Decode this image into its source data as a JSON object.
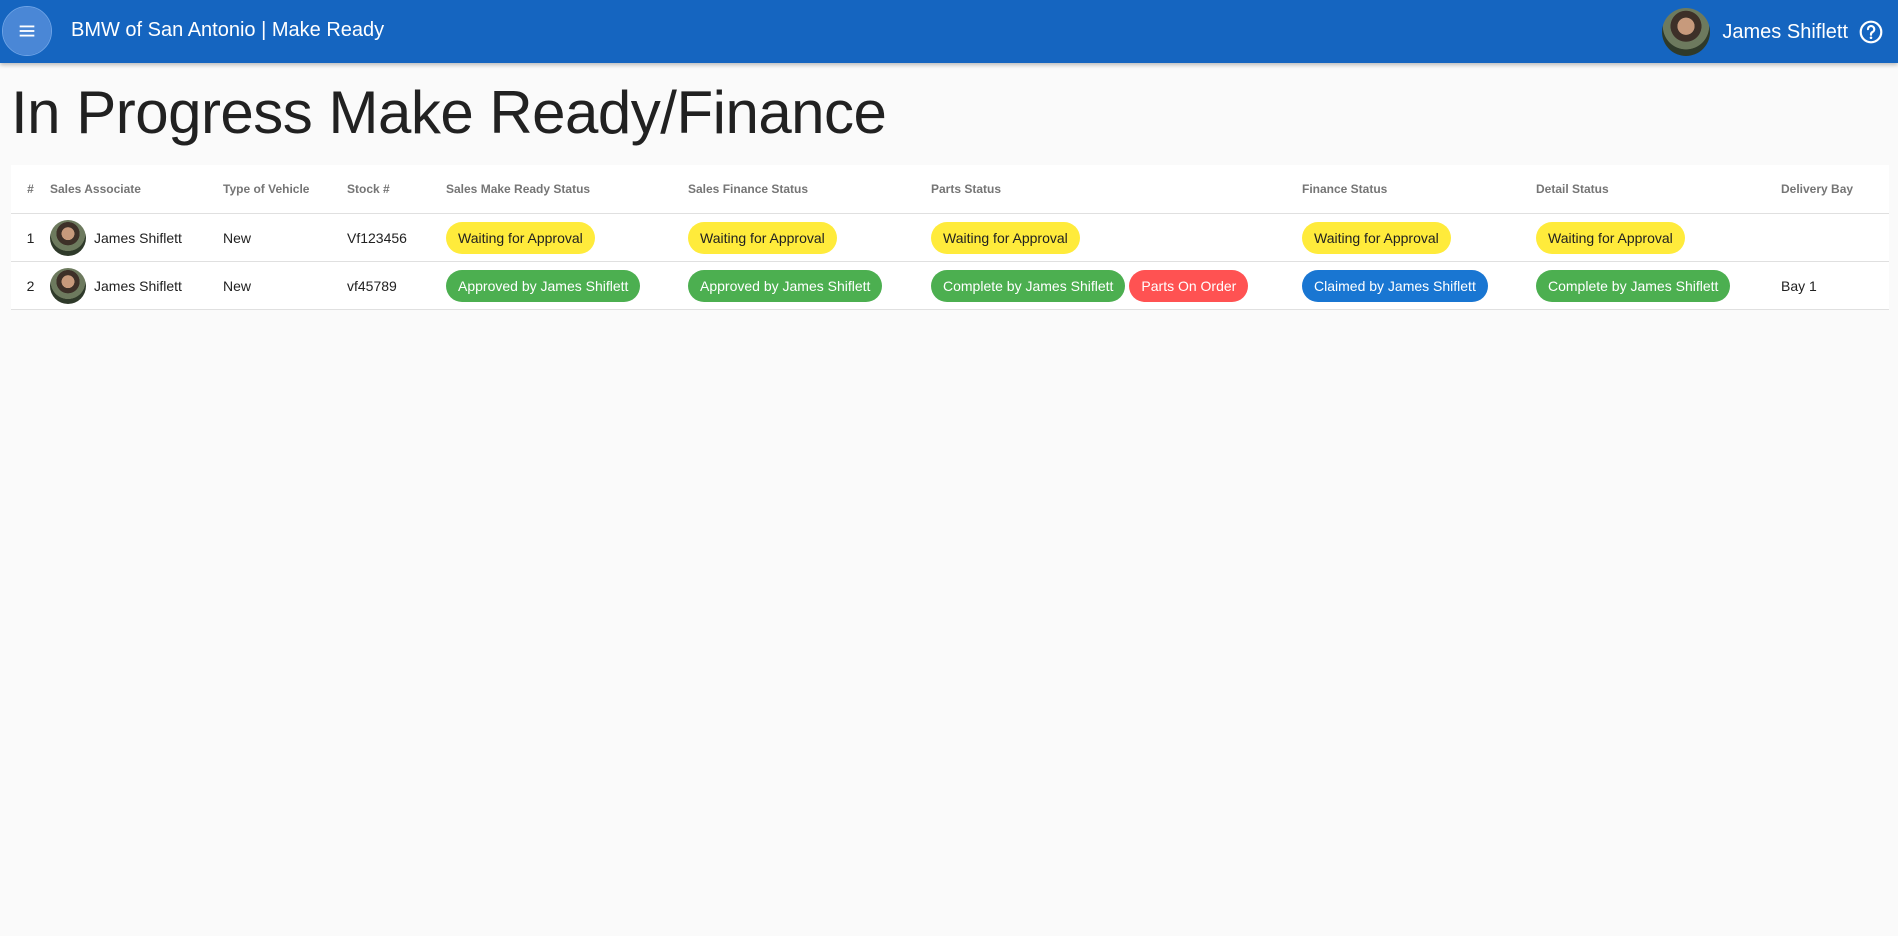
{
  "header": {
    "title": "BMW of San Antonio | Make Ready",
    "user_name": "James Shiflett",
    "bg_color": "#1565c0"
  },
  "page": {
    "title": "In Progress Make Ready/Finance"
  },
  "table": {
    "headers": {
      "num": "#",
      "associate": "Sales Associate",
      "vehicle_type": "Type of Vehicle",
      "stock": "Stock #",
      "make_ready": "Sales Make Ready Status",
      "sales_finance": "Sales Finance Status",
      "parts": "Parts Status",
      "finance": "Finance Status",
      "detail": "Detail Status",
      "delivery_bay": "Delivery Bay"
    },
    "rows": [
      {
        "num": "1",
        "associate": "James Shiflett",
        "vehicle_type": "New",
        "stock": "Vf123456",
        "make_ready": "Waiting for Approval",
        "sales_finance": "Waiting for Approval",
        "parts": "Waiting for Approval",
        "parts_extra": "",
        "finance": "Waiting for Approval",
        "detail": "Waiting for Approval",
        "delivery_bay": ""
      },
      {
        "num": "2",
        "associate": "James Shiflett",
        "vehicle_type": "New",
        "stock": "vf45789",
        "make_ready": "Approved by James Shiflett",
        "sales_finance": "Approved by James Shiflett",
        "parts": "Complete by James Shiflett",
        "parts_extra": "Parts On Order",
        "finance": "Claimed by James Shiflett",
        "detail": "Complete by James Shiflett",
        "delivery_bay": "Bay 1"
      }
    ]
  },
  "colors": {
    "waiting": "#ffeb3b",
    "approved": "#4caf50",
    "alert": "#ff5252",
    "claimed": "#1976d2"
  },
  "icons": {
    "menu": "menu-icon",
    "help": "help-circle-icon",
    "avatar": "user-avatar"
  }
}
